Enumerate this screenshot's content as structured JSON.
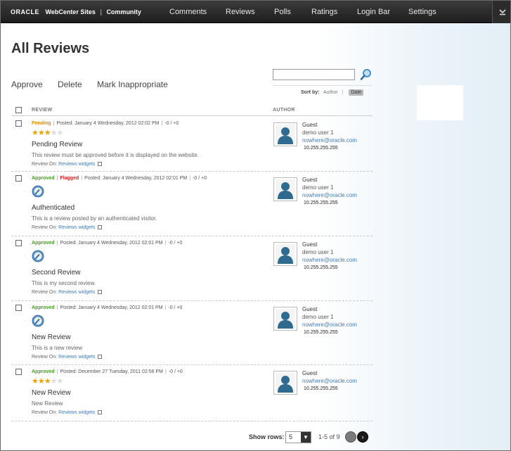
{
  "header": {
    "oracle": "ORACLE",
    "product": "WebCenter Sites",
    "section": "Community",
    "nav": [
      "Comments",
      "Reviews",
      "Polls",
      "Ratings",
      "Login Bar",
      "Settings"
    ],
    "collapse_icon": "chevron-down-icon"
  },
  "page": {
    "title": "All Reviews"
  },
  "actions": {
    "approve": "Approve",
    "delete": "Delete",
    "mark": "Mark Inappropriate"
  },
  "search": {
    "value": "",
    "placeholder": ""
  },
  "sort": {
    "label": "Sort by:",
    "author": "Author",
    "separator": "|",
    "date": "Date"
  },
  "columns": {
    "review": "REVIEW",
    "author": "AUTHOR"
  },
  "reviews": [
    {
      "status": "Pending",
      "flag": "",
      "posted": "Posted: January 4 Wednesday, 2012 02:02 PM",
      "votes": "-0 / +0",
      "rating": 3,
      "rating_max": 5,
      "authenticated": false,
      "title": "Pending Review",
      "body": "This review must be approved before it is displayed on the website.",
      "review_on_label": "Review On:",
      "review_on_link": "Reviews widgets",
      "author": {
        "name": "Guest",
        "user": "demo user 1",
        "email": "nowhere@oracle.com",
        "ip": "10.255.255.255"
      }
    },
    {
      "status": "Approved",
      "flag": "Flagged",
      "posted": "Posted: January 4 Wednesday, 2012 02:01 PM",
      "votes": "-0 / +0",
      "rating": 0,
      "rating_max": 5,
      "authenticated": true,
      "title": "Authenticated",
      "body": "This is a review posted by an authenticated visitor.",
      "review_on_label": "Review On:",
      "review_on_link": "Reviews widgets",
      "author": {
        "name": "Guest",
        "user": "demo user 1",
        "email": "nowhere@oracle.com",
        "ip": "10.255.255.255"
      }
    },
    {
      "status": "Approved",
      "flag": "",
      "posted": "Posted: January 4 Wednesday, 2012 02:01 PM",
      "votes": "-0 / +0",
      "rating": 0,
      "rating_max": 5,
      "authenticated": true,
      "title": "Second Review",
      "body": "This is my second review.",
      "review_on_label": "Review On:",
      "review_on_link": "Reviews widgets",
      "author": {
        "name": "Guest",
        "user": "demo user 1",
        "email": "nowhere@oracle.com",
        "ip": "10.255.255.255"
      }
    },
    {
      "status": "Approved",
      "flag": "",
      "posted": "Posted: January 4 Wednesday, 2012 02:01 PM",
      "votes": "-0 / +0",
      "rating": 0,
      "rating_max": 5,
      "authenticated": true,
      "title": "New Review",
      "body": "This is a new review",
      "review_on_label": "Review On:",
      "review_on_link": "Reviews widgets",
      "author": {
        "name": "Guest",
        "user": "demo user 1",
        "email": "nowhere@oracle.com",
        "ip": "10.255.255.255"
      }
    },
    {
      "status": "Approved",
      "flag": "",
      "posted": "Posted: December 27 Tuesday, 2011 02:56 PM",
      "votes": "-0 / +0",
      "rating": 3,
      "rating_max": 5,
      "authenticated": false,
      "title": "New Review",
      "body": "New Review",
      "review_on_label": "Review On:",
      "review_on_link": "Reviews widgets",
      "author": {
        "name": "Guest",
        "user": "",
        "email": "nowhere@oracle.com",
        "ip": "10.255.255.255"
      }
    }
  ],
  "pager": {
    "label": "Show rows:",
    "rows": "5",
    "range": "1-5 of 9"
  },
  "colors": {
    "approved": "#4a9a2a",
    "pending": "#e08a00",
    "flagged": "#d01f1f",
    "link": "#3f7bbf",
    "star": "#e9a400"
  }
}
